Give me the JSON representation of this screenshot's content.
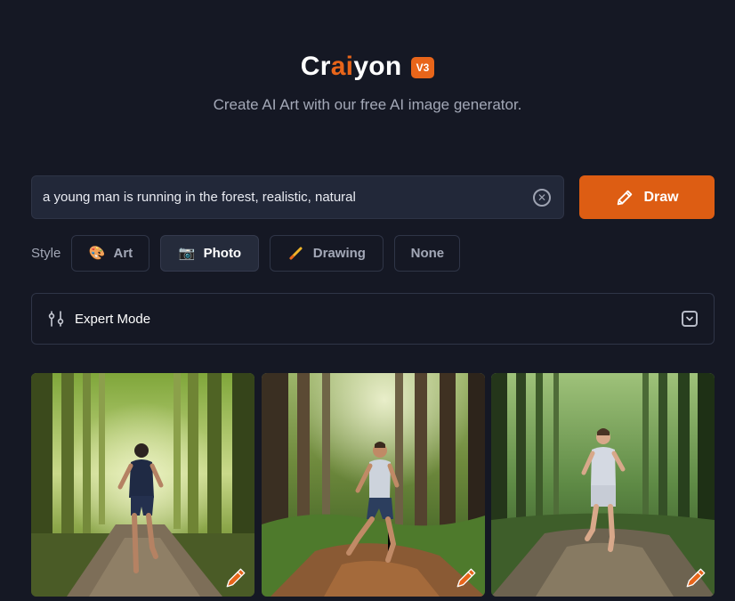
{
  "brand": {
    "name_prefix": "Cr",
    "name_accent": "ai",
    "name_suffix": "yon",
    "version": "V3",
    "subtitle": "Create AI Art with our free AI image generator."
  },
  "prompt": {
    "value": "a young man is running in the forest, realistic, natural",
    "clear_icon": "close-circle-icon"
  },
  "draw_button": {
    "label": "Draw",
    "icon": "pencil-icon"
  },
  "style": {
    "label": "Style",
    "options": [
      {
        "label": "Art",
        "icon": "palette-icon",
        "active": false
      },
      {
        "label": "Photo",
        "icon": "camera-icon",
        "active": true
      },
      {
        "label": "Drawing",
        "icon": "pencil-icon",
        "active": false
      },
      {
        "label": "None",
        "icon": "",
        "active": false
      }
    ]
  },
  "expert_mode": {
    "label": "Expert Mode",
    "icon": "sliders-icon",
    "toggle_icon": "chevron-down-icon"
  },
  "gallery": {
    "images": [
      {
        "description_icon": "generated-image",
        "edit_icon": "pencil-icon"
      },
      {
        "description_icon": "generated-image",
        "edit_icon": "pencil-icon"
      },
      {
        "description_icon": "generated-image",
        "edit_icon": "pencil-icon"
      }
    ]
  },
  "colors": {
    "background": "#151824",
    "accent": "#e8651a",
    "input_bg": "#222839"
  }
}
